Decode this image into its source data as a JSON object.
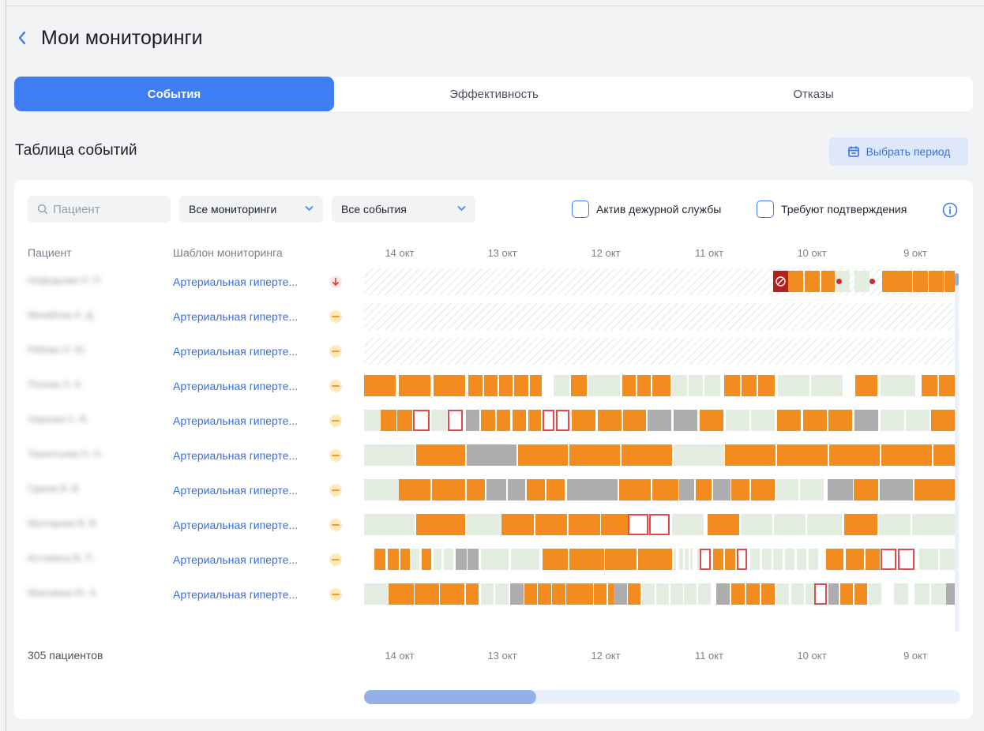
{
  "header": {
    "title": "Мои мониторинги",
    "back_icon": "chevron-left-icon"
  },
  "tabs": [
    {
      "label": "События",
      "active": true
    },
    {
      "label": "Эффективность",
      "active": false
    },
    {
      "label": "Отказы",
      "active": false
    }
  ],
  "section": {
    "title": "Таблица событий",
    "period_button": "Выбрать период",
    "period_icon": "calendar-icon"
  },
  "filters": {
    "search_placeholder": "Пациент",
    "monitorings_select": "Все мониторинги",
    "events_select": "Все события",
    "checkbox_duty": "Актив дежурной службы",
    "checkbox_confirm": "Требуют подтверждения"
  },
  "table": {
    "col_patient": "Пациент",
    "col_template": "Шаблон мониторинга",
    "dates": [
      "14 окт",
      "13 окт",
      "12 окт",
      "11 окт",
      "10 окт",
      "9 окт"
    ],
    "rows": [
      {
        "name": "Нефедьева Н. П.",
        "template": "Артериальная гиперте...",
        "status": "arrow-down-icon"
      },
      {
        "name": "Михайлов А. Д.",
        "template": "Артериальная гиперте...",
        "status": "minus-circle-icon"
      },
      {
        "name": "Рябова О. Ю.",
        "template": "Артериальная гиперте...",
        "status": "minus-circle-icon"
      },
      {
        "name": "Попова Л. А.",
        "template": "Артериальная гиперте...",
        "status": "minus-circle-icon"
      },
      {
        "name": "Чернова С. В.",
        "template": "Артериальная гиперте...",
        "status": "minus-circle-icon"
      },
      {
        "name": "Терентьева Н. Н.",
        "template": "Артериальная гиперте...",
        "status": "minus-circle-icon"
      },
      {
        "name": "Гуреев В. В.",
        "template": "Артериальная гиперте...",
        "status": "minus-circle-icon"
      },
      {
        "name": "Мухтарова В. В.",
        "template": "Артериальная гиперте...",
        "status": "minus-circle-icon"
      },
      {
        "name": "Истомина В. П.",
        "template": "Артериальная гиперте...",
        "status": "minus-circle-icon"
      },
      {
        "name": "Максимов Ю. А.",
        "template": "Артериальная гиперте...",
        "status": "minus-circle-icon"
      }
    ],
    "footer_count": "305 пациентов"
  },
  "colors": {
    "accent": "#3f7df5",
    "event_orange": "#f28c1e",
    "event_gray": "#adadad",
    "event_light": "#e3eee1",
    "event_red": "#e14b4b"
  }
}
